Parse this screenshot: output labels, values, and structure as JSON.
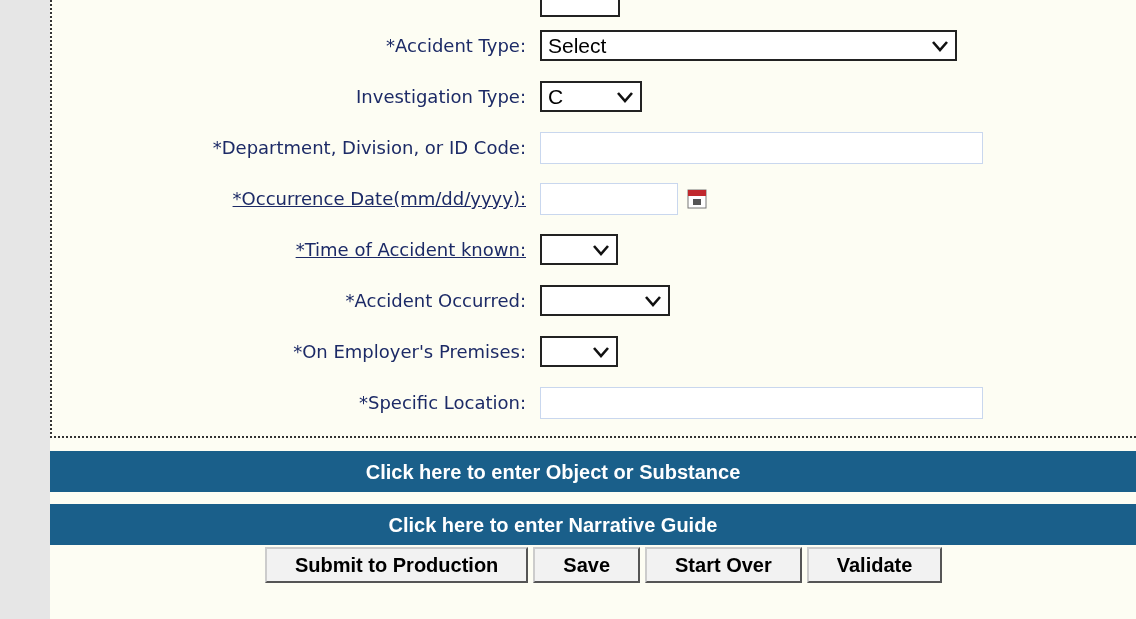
{
  "fields": [
    {
      "label": "*Accident Type:",
      "link": false,
      "kind": "select",
      "value": "Select"
    },
    {
      "label": "Investigation Type:",
      "link": false,
      "kind": "select",
      "value": "C"
    },
    {
      "label": "*Department, Division, or ID Code:",
      "link": false,
      "kind": "text"
    },
    {
      "label": "*Occurrence Date(mm/dd/yyyy):",
      "link": true,
      "kind": "date"
    },
    {
      "label": "*Time of Accident known:",
      "link": true,
      "kind": "select"
    },
    {
      "label": "*Accident Occurred:",
      "link": false,
      "kind": "select"
    },
    {
      "label": "*On Employer's Premises:",
      "link": false,
      "kind": "select"
    },
    {
      "label": "*Specific Location:",
      "link": false,
      "kind": "text"
    }
  ],
  "sections": [
    "Click here to enter Object or Substance",
    "Click here to enter Narrative Guide"
  ],
  "buttons": [
    "Submit to Production",
    "Save",
    "Start Over",
    "Validate"
  ]
}
